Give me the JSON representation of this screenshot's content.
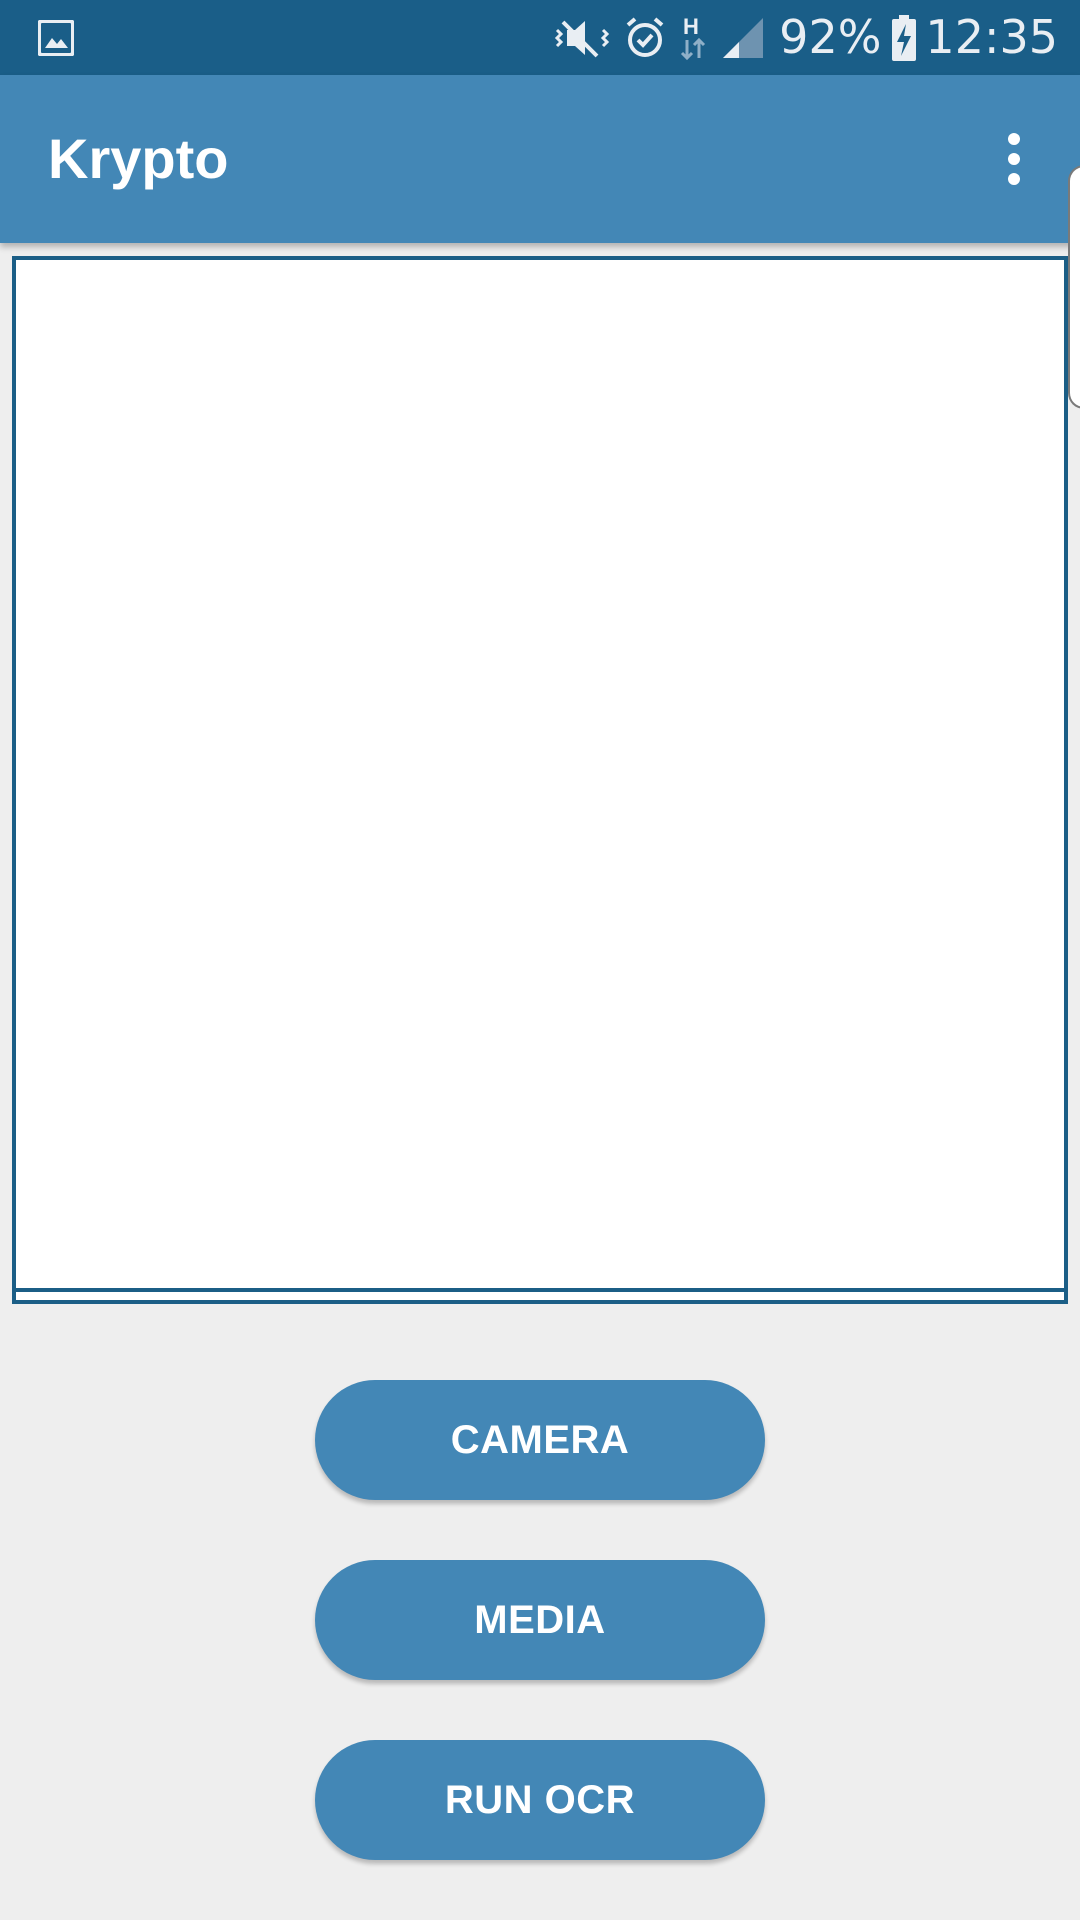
{
  "status_bar": {
    "icons": [
      "gallery-icon",
      "mute-icon",
      "alarm-icon",
      "hspa-data-icon",
      "signal-icon",
      "battery-charging-icon"
    ],
    "network_type": "H",
    "battery_percent": "92%",
    "time": "12:35"
  },
  "app_bar": {
    "title": "Krypto",
    "menu_icon": "more-vert-icon"
  },
  "actions": {
    "camera_label": "CAMERA",
    "media_label": "MEDIA",
    "run_ocr_label": "RUN OCR"
  },
  "colors": {
    "status_bar": "#1a5e88",
    "app_bar": "#4387b6",
    "button": "#4387b6",
    "preview_border": "#1b5e86",
    "background": "#eeeeee"
  }
}
